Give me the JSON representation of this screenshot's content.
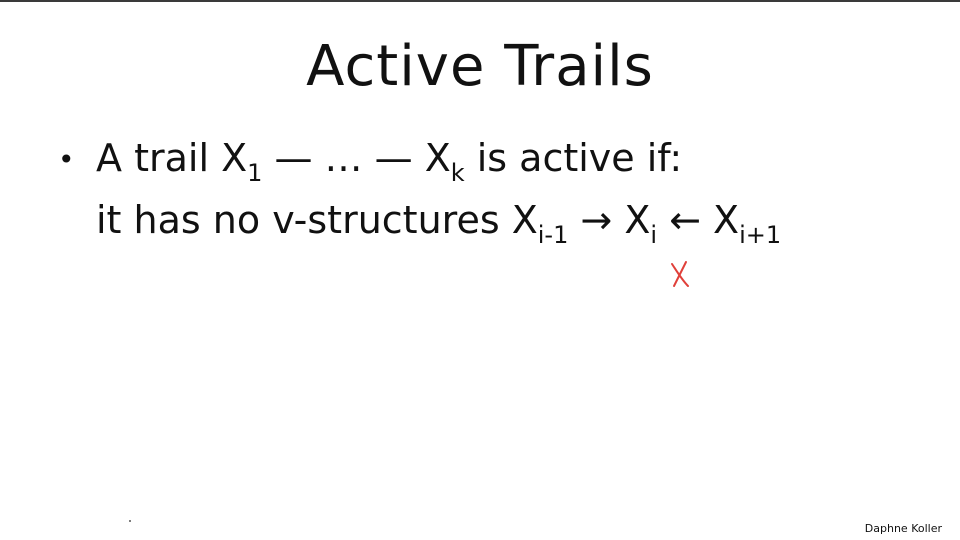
{
  "slide": {
    "title": "Active Trails",
    "bullet_symbol": "•",
    "line1": {
      "a": "A trail X",
      "sub1": "1",
      "b": " — … — X",
      "sub2": "k",
      "c": " is active if:"
    },
    "line2": {
      "a": "it has no v-structures X",
      "sub1": "i-1",
      "b": " → X",
      "sub2": "i",
      "c": " ← X",
      "sub3": "i+1"
    },
    "annotation_mark": "x",
    "speaker": "Daphne Koller"
  }
}
